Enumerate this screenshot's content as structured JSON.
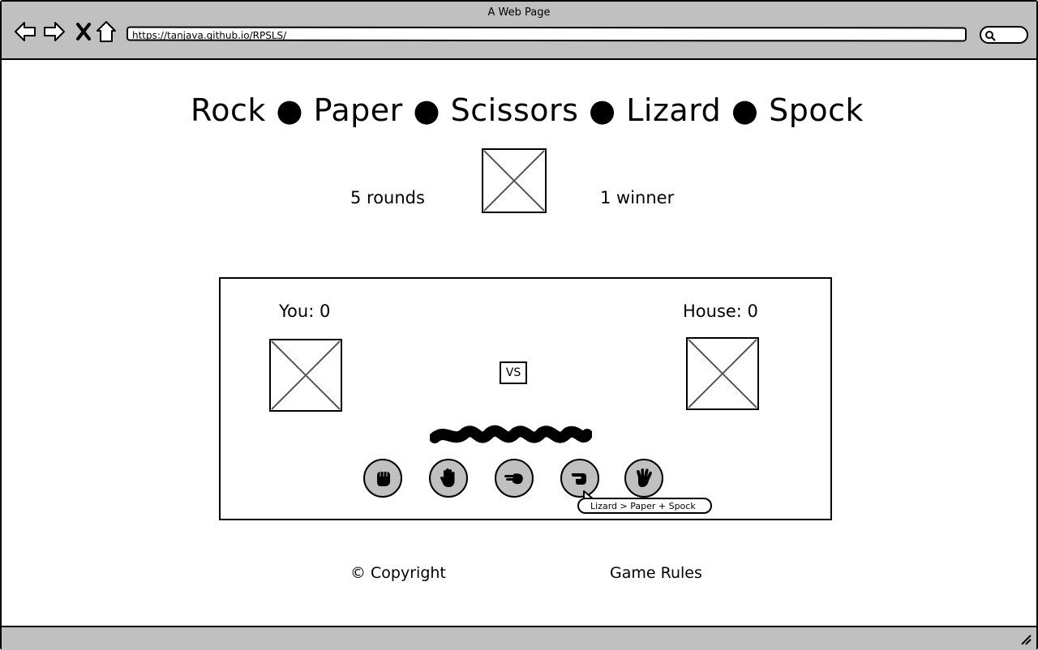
{
  "browser": {
    "window_title": "A Web Page",
    "url": "https://tanjava.github.io/RPSLS/",
    "nav_icons": [
      "back-arrow-icon",
      "forward-arrow-icon",
      "close-x-icon",
      "home-icon"
    ]
  },
  "header": {
    "title": "Rock ● Paper ● Scissors ● Lizard ● Spock",
    "rounds_text": "5 rounds",
    "winner_text": "1 winner"
  },
  "game": {
    "player_score": "You: 0",
    "house_score": "House: 0",
    "vs_label": "VS",
    "choices": [
      {
        "name": "rock",
        "icon": "fist-icon"
      },
      {
        "name": "paper",
        "icon": "open-hand-icon"
      },
      {
        "name": "scissors",
        "icon": "scissors-hand-icon"
      },
      {
        "name": "lizard",
        "icon": "lizard-hand-icon"
      },
      {
        "name": "spock",
        "icon": "vulcan-salute-icon"
      }
    ],
    "tooltip": "Lizard > Paper + Spock"
  },
  "footer": {
    "copyright": "© Copyright",
    "rules_link": "Game Rules"
  },
  "colors": {
    "chrome_gray": "#c0c0c0",
    "button_gray": "#c0c0c0",
    "outline": "#000000",
    "placeholder_line": "#555555"
  }
}
